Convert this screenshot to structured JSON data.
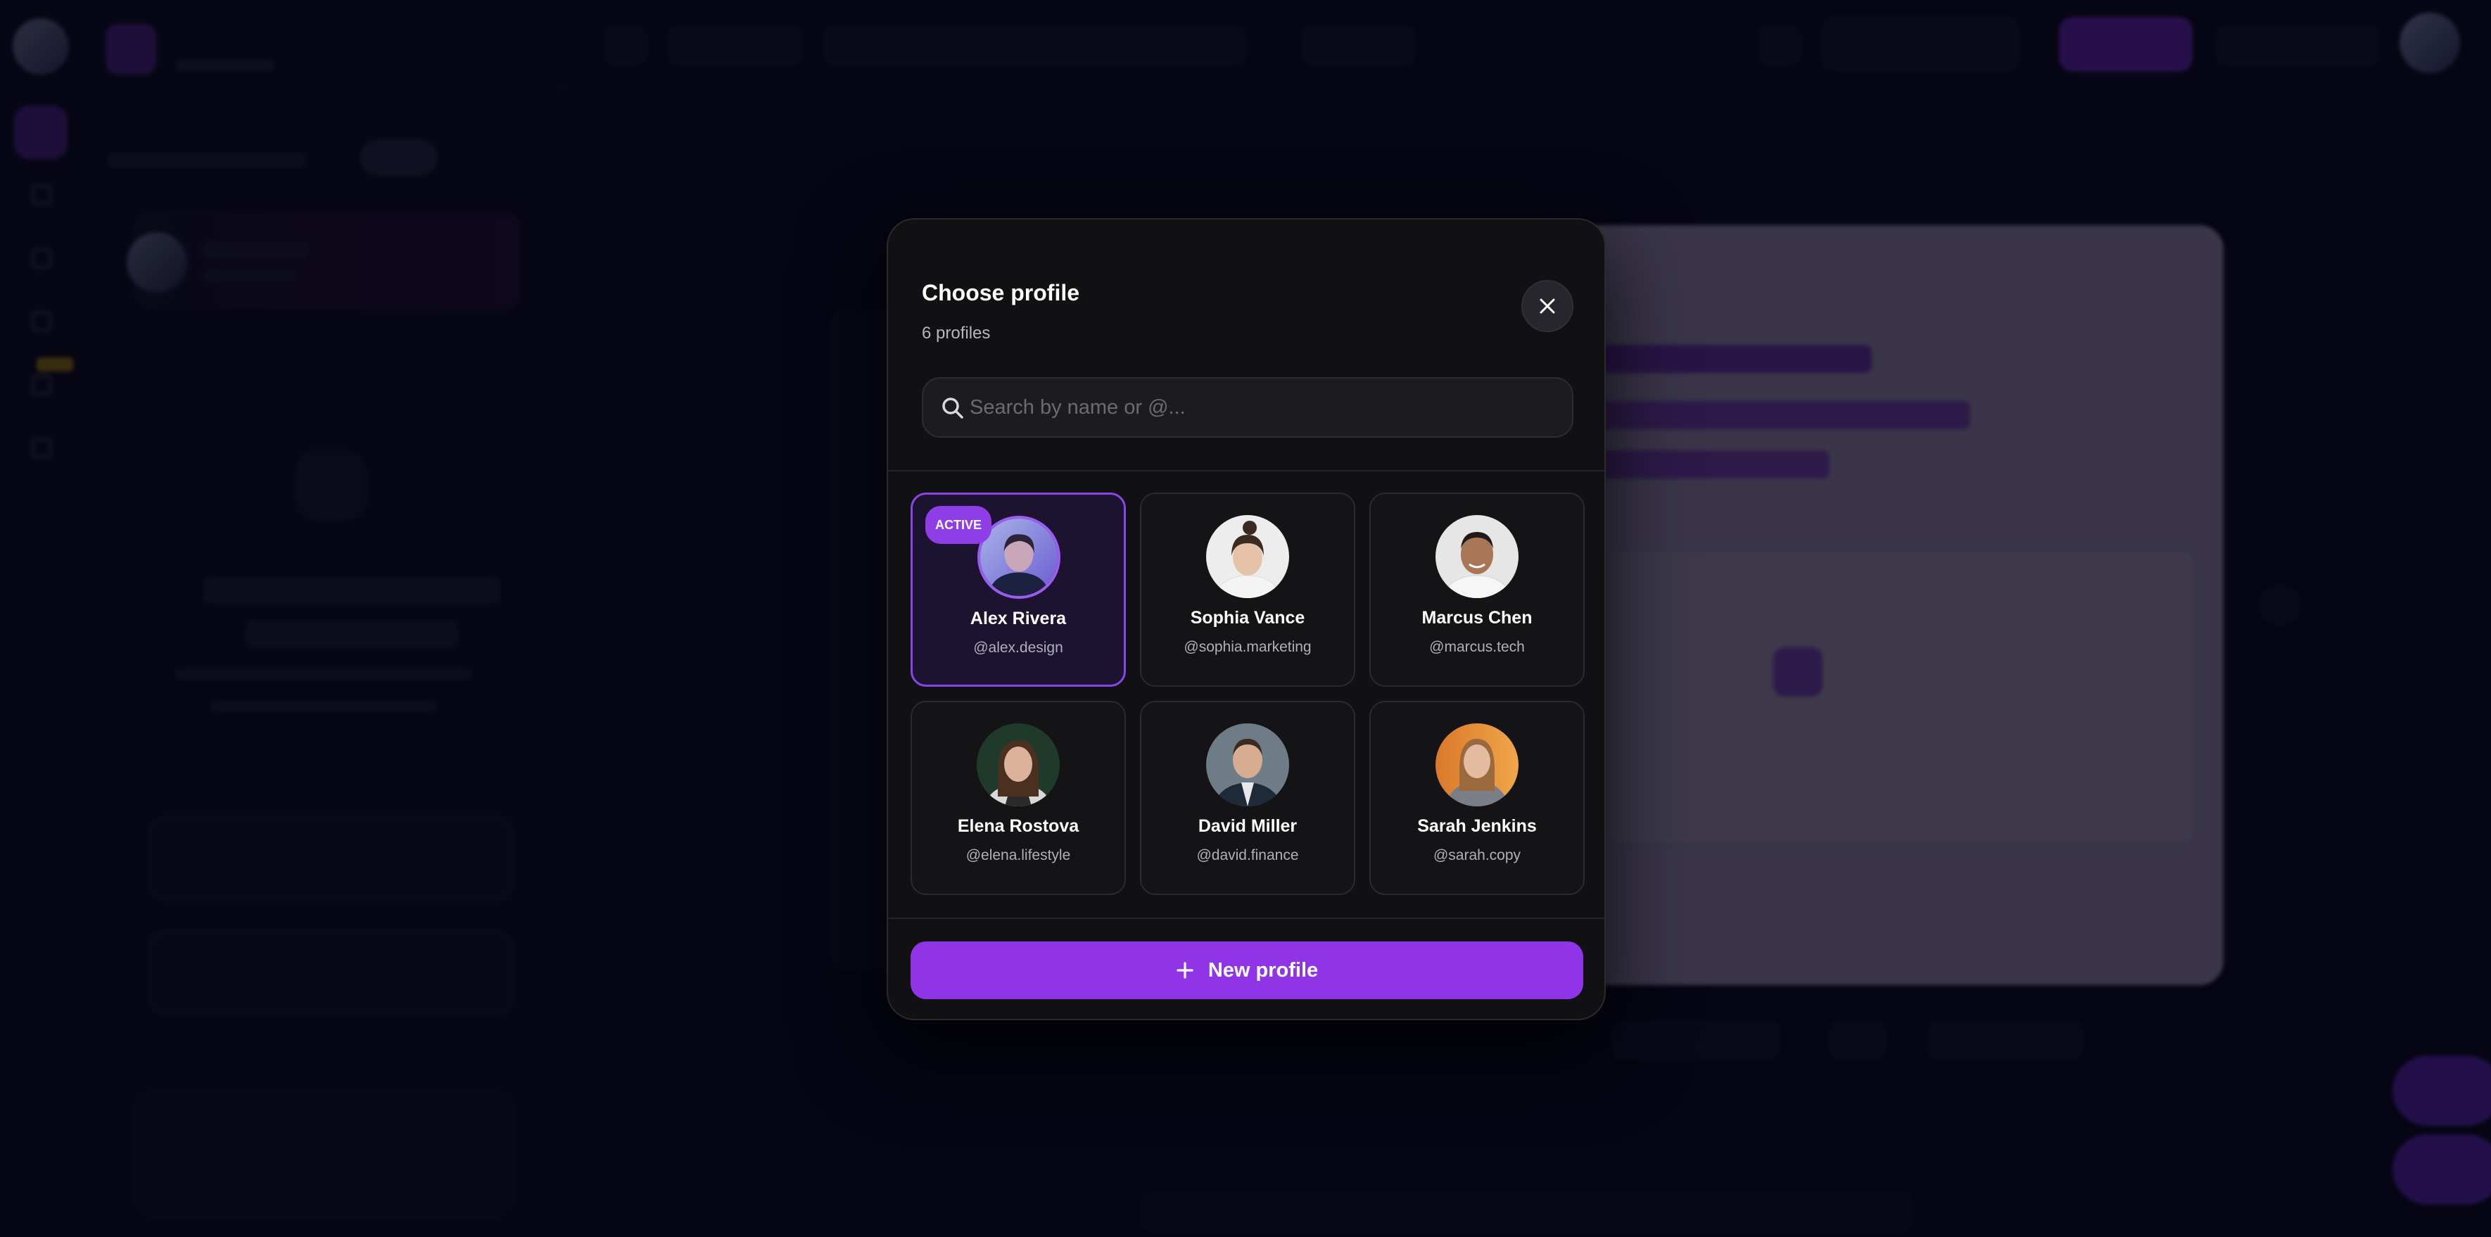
{
  "modal": {
    "title": "Choose profile",
    "count": "6 profiles",
    "search_placeholder": "Search by name or @...",
    "active_badge": "ACTIVE",
    "new_profile_label": "New profile",
    "profiles": [
      {
        "name": "Alex Rivera",
        "handle": "@alex.design",
        "active": true
      },
      {
        "name": "Sophia Vance",
        "handle": "@sophia.marketing",
        "active": false
      },
      {
        "name": "Marcus Chen",
        "handle": "@marcus.tech",
        "active": false
      },
      {
        "name": "Elena Rostova",
        "handle": "@elena.lifestyle",
        "active": false
      },
      {
        "name": "David Miller",
        "handle": "@david.finance",
        "active": false
      },
      {
        "name": "Sarah Jenkins",
        "handle": "@sarah.copy",
        "active": false
      }
    ]
  },
  "colors": {
    "accent": "#8f34e6",
    "modal_bg": "#111113",
    "card_bg": "#141416",
    "active_border": "#8b45e6"
  },
  "icons": {
    "close": "close-icon",
    "search": "search-icon",
    "plus": "plus-icon"
  }
}
